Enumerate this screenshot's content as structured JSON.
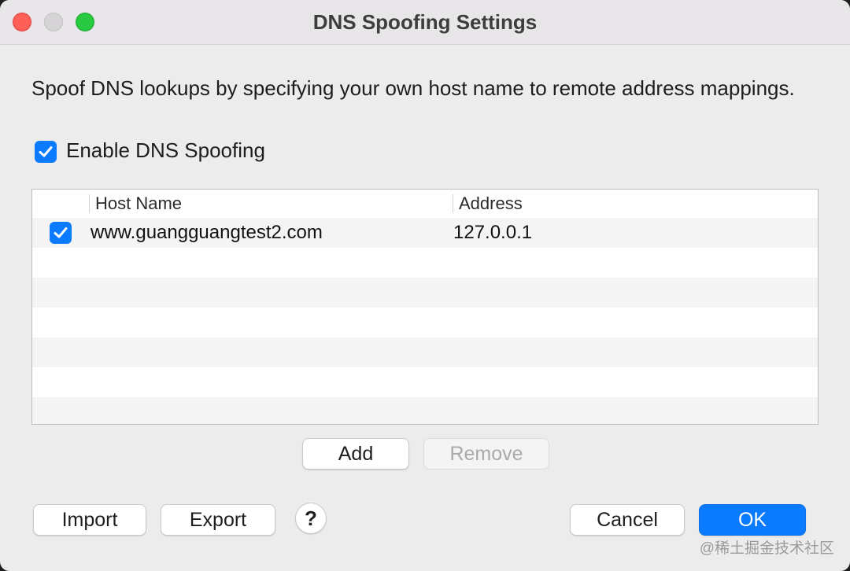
{
  "window": {
    "title": "DNS Spoofing Settings",
    "traffic_lights": [
      "close",
      "minimize",
      "zoom"
    ]
  },
  "description": "Spoof DNS lookups by specifying your own host name to remote address mappings.",
  "enable": {
    "label": "Enable DNS Spoofing",
    "checked": true
  },
  "table": {
    "columns": [
      "Host Name",
      "Address"
    ],
    "rows": [
      {
        "enabled": true,
        "host": "www.guangguangtest2.com",
        "address": "127.0.0.1"
      }
    ]
  },
  "buttons": {
    "add": "Add",
    "remove": "Remove",
    "import": "Import",
    "export": "Export",
    "help": "?",
    "cancel": "Cancel",
    "ok": "OK"
  },
  "watermark": "@稀土掘金技术社区",
  "colors": {
    "accent": "#0a7aff",
    "close": "#fe5f57",
    "zoom": "#28c840"
  }
}
